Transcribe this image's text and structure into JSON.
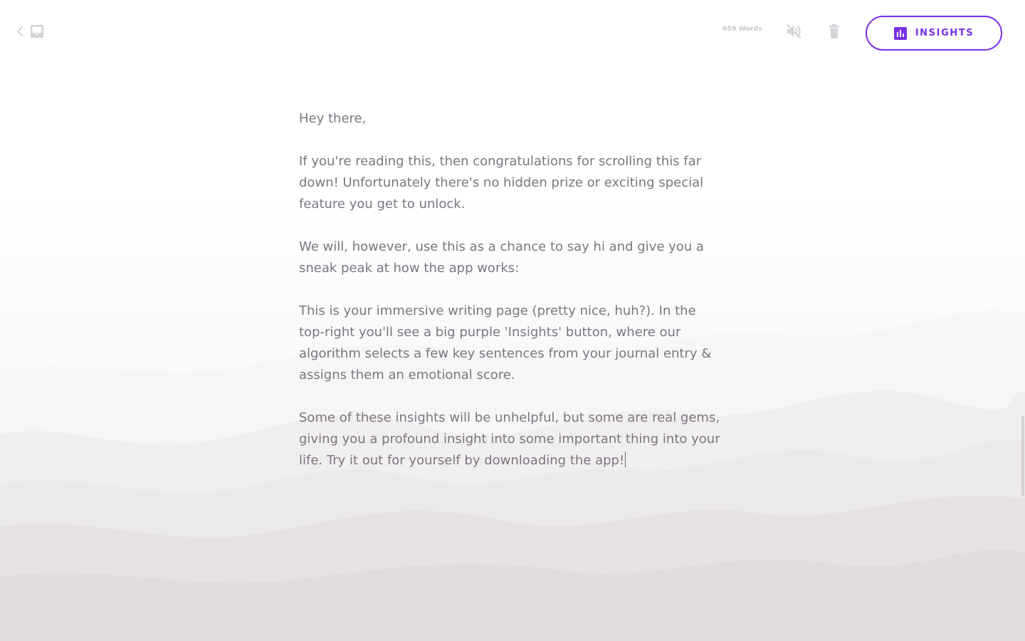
{
  "toolbar": {
    "back_icon": "chevron-left-icon",
    "inbox_icon": "inbox-icon",
    "word_count": "659 Words",
    "mute_icon": "volume-off-icon",
    "trash_icon": "trash-icon",
    "insights_icon": "bar-chart-icon",
    "insights_label": "INSIGHTS"
  },
  "editor": {
    "paragraphs": [
      "Hey there,",
      "If you're reading this, then congratulations for scrolling this far down! Unfortunately there's no hidden prize or exciting special feature you get to unlock.",
      "We will, however, use this as a chance to say hi and give you a sneak peak at how the app works:",
      "This is your immersive writing page (pretty nice, huh?). In the top-right you'll see a big purple 'Insights' button, where our algorithm selects a few key sentences from your journal entry & assigns them an emotional score.",
      "Some of these insights will be unhelpful, but some are real gems, giving you a profound insight into some important thing into your life. Try it out for yourself by downloading the app!"
    ]
  },
  "colors": {
    "accent": "#7a2fe6",
    "text": "#7b7680",
    "muted_icon": "#d4d1d6",
    "background": "#ffffff"
  }
}
